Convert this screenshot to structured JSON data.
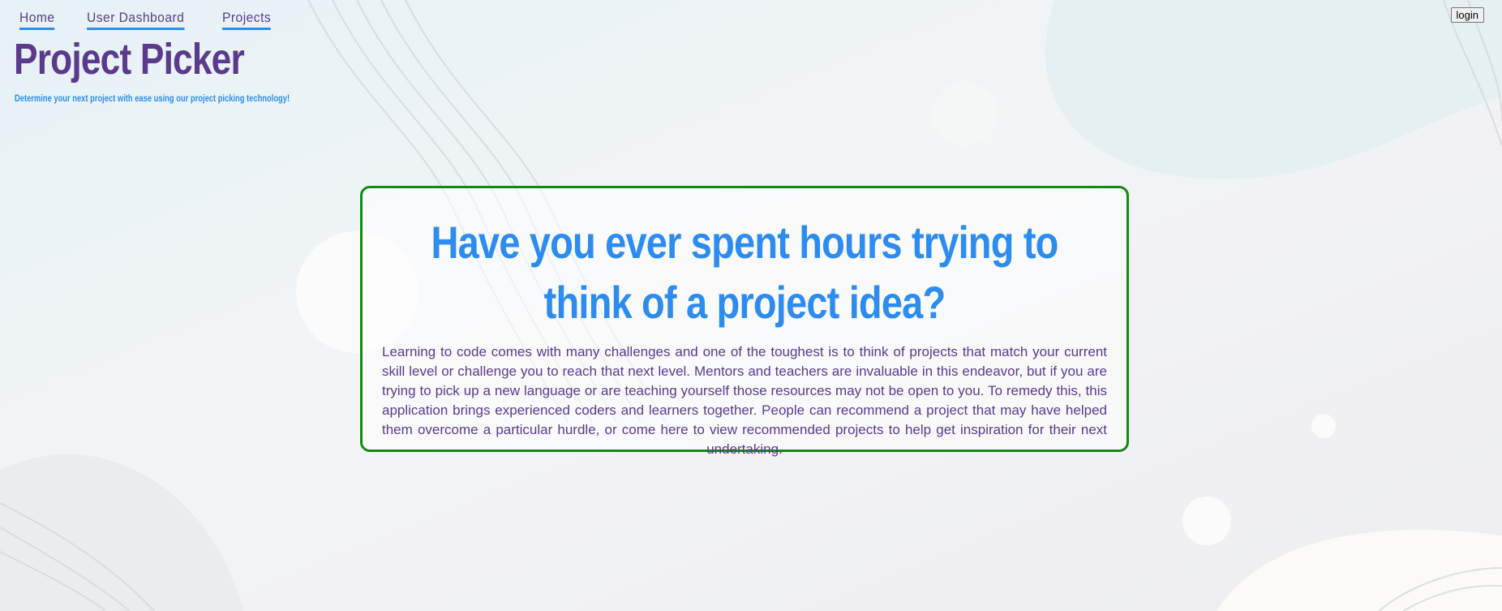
{
  "nav": {
    "items": [
      {
        "label": "Home"
      },
      {
        "label": "User Dashboard"
      },
      {
        "label": "Projects"
      }
    ]
  },
  "header": {
    "login_label": "login",
    "title": "Project Picker",
    "subtitle": "Determine your next project with ease using our project picking technology!"
  },
  "hero": {
    "heading": "Have you ever spent hours trying to think of a project idea?",
    "body": "Learning to code comes with many challenges and one of the toughest is to think of projects that match your current skill level or challenge you to reach that next level. Mentors and teachers are invaluable in this endeavor, but if you are trying to pick up a new language or are teaching yourself those resources may not be open to you. To remedy this, this application brings experienced coders and learners together. People can recommend a project that may have helped them overcome a particular hurdle, or come here to view recommended projects to help get inspiration for their next undertaking."
  },
  "colors": {
    "brand_purple": "#5b3a8c",
    "accent_blue": "#2d8cf0",
    "card_border_green": "#138a13"
  }
}
